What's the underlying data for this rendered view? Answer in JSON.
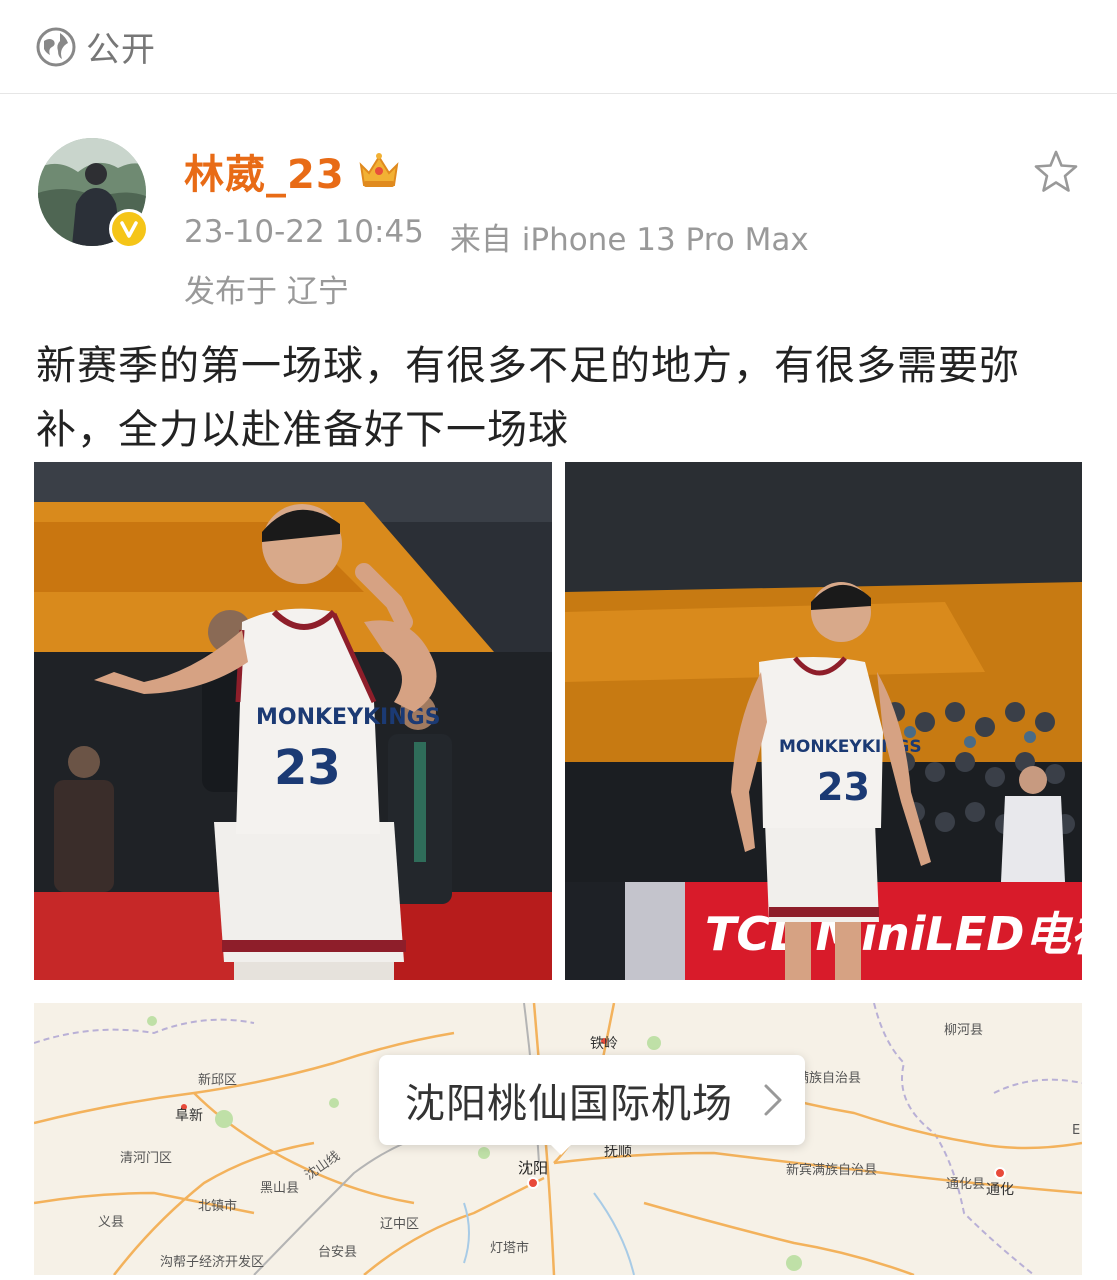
{
  "visibility": {
    "label": "公开",
    "icon": "globe-icon"
  },
  "post": {
    "username": "林葳_23",
    "timestamp": "23-10-22 10:45",
    "source": "来自 iPhone 13 Pro Max",
    "location": "发布于 辽宁",
    "text": "新赛季的第一场球，有很多不足的地方，有很多需要弥补，全力以赴准备好下一场球",
    "verified_icon": "verified-badge-icon",
    "member_icon": "crown-icon",
    "favorite_icon": "star-icon"
  },
  "photos": [
    {
      "jersey_team": "MONKEYKINGS",
      "jersey_number": "23"
    },
    {
      "jersey_team": "MONKEYKINGS",
      "jersey_number": "23",
      "banner_text": "TCL MiniLED电视 中国"
    }
  ],
  "map": {
    "place_name": "沈阳桃仙国际机场",
    "labels": {
      "tieling": "铁岭",
      "xinqiu": "新邱区",
      "fuxin": "阜新",
      "qinghemen": "清河门区",
      "heishan": "黑山县",
      "beizhen": "北镇市",
      "yixian": "义县",
      "linghai": "沟帮子经济开发区",
      "shenyang": "沈阳",
      "fushun": "抚顺",
      "liaozhong": "辽中区",
      "taian": "台安县",
      "dengta": "灯塔市",
      "qingyuan": "清原满族自治县",
      "xinbin": "新宾满族自治县",
      "liuhe": "柳河县",
      "tonghuaxian": "通化县",
      "tonghua": "通化",
      "shenshan": "沈山线",
      "e": "E"
    }
  }
}
